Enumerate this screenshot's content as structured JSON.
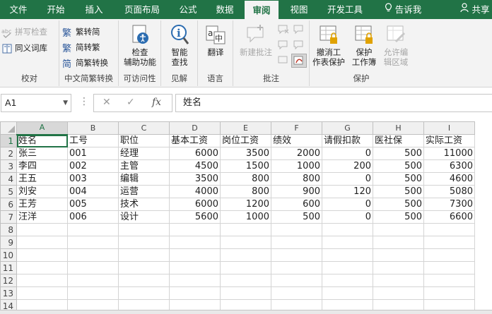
{
  "tabs": [
    {
      "label": "文件",
      "active": false
    },
    {
      "label": "开始",
      "active": false
    },
    {
      "label": "插入",
      "active": false
    },
    {
      "label": "页面布局",
      "active": false
    },
    {
      "label": "公式",
      "active": false
    },
    {
      "label": "数据",
      "active": false
    },
    {
      "label": "审阅",
      "active": true
    },
    {
      "label": "视图",
      "active": false
    },
    {
      "label": "开发工具",
      "active": false
    },
    {
      "label": "告诉我",
      "active": false,
      "icon": "lightbulb-icon"
    },
    {
      "label": "共享",
      "active": false,
      "icon": "person-icon"
    }
  ],
  "ribbon": {
    "proofing": {
      "label": "校对",
      "spell_check": "拼写检查",
      "thesaurus": "同义词库"
    },
    "chinese_conversion": {
      "label": "中文简繁转换",
      "to_simplified": "繁转简",
      "to_traditional": "简转繁",
      "convert": "简繁转换"
    },
    "accessibility": {
      "label": "可访问性",
      "check_l1": "检查",
      "check_l2": "辅助功能"
    },
    "insights": {
      "label": "见解",
      "smart_l1": "智能",
      "smart_l2": "查找"
    },
    "language": {
      "label": "语言",
      "translate": "翻译"
    },
    "comments": {
      "label": "批注",
      "new_comment": "新建批注"
    },
    "protect": {
      "label": "保护",
      "unprotect_l1": "撤消工",
      "unprotect_l2": "作表保护",
      "protect_wb_l1": "保护",
      "protect_wb_l2": "工作簿",
      "allow_edit_l1": "允许编",
      "allow_edit_l2": "辑区域"
    }
  },
  "formula_bar": {
    "name_box": "A1",
    "cancel": "✕",
    "enter": "✓",
    "fx": "fx",
    "content": "姓名"
  },
  "colors": {
    "accent": "#217346",
    "ribbon_bg": "#f3f3f3",
    "grid_line": "#d4d4d4"
  },
  "sheet": {
    "columns": [
      "A",
      "B",
      "C",
      "D",
      "E",
      "F",
      "G",
      "H",
      "I"
    ],
    "rows": [
      [
        "姓名",
        "工号",
        "职位",
        "基本工资",
        "岗位工资",
        "绩效",
        "请假扣款",
        "医社保",
        "实际工资"
      ],
      [
        "张三",
        "001",
        "经理",
        "6000",
        "3500",
        "2000",
        "0",
        "500",
        "11000"
      ],
      [
        "李四",
        "002",
        "主管",
        "4500",
        "1500",
        "1000",
        "200",
        "500",
        "6300"
      ],
      [
        "王五",
        "003",
        "编辑",
        "3500",
        "800",
        "800",
        "0",
        "500",
        "4600"
      ],
      [
        "刘安",
        "004",
        "运营",
        "4000",
        "800",
        "900",
        "120",
        "500",
        "5080"
      ],
      [
        "王芳",
        "005",
        "技术",
        "6000",
        "1200",
        "600",
        "0",
        "500",
        "7300"
      ],
      [
        "汪洋",
        "006",
        "设计",
        "5600",
        "1000",
        "500",
        "0",
        "500",
        "6600"
      ],
      [
        "",
        "",
        "",
        "",
        "",
        "",
        "",
        "",
        ""
      ],
      [
        "",
        "",
        "",
        "",
        "",
        "",
        "",
        "",
        ""
      ],
      [
        "",
        "",
        "",
        "",
        "",
        "",
        "",
        "",
        ""
      ],
      [
        "",
        "",
        "",
        "",
        "",
        "",
        "",
        "",
        ""
      ],
      [
        "",
        "",
        "",
        "",
        "",
        "",
        "",
        "",
        ""
      ],
      [
        "",
        "",
        "",
        "",
        "",
        "",
        "",
        "",
        ""
      ],
      [
        "",
        "",
        "",
        "",
        "",
        "",
        "",
        "",
        ""
      ]
    ],
    "row_numbers": [
      "1",
      "2",
      "3",
      "4",
      "5",
      "6",
      "7",
      "8",
      "9",
      "10",
      "11",
      "12",
      "13",
      "14"
    ],
    "selected_cell": "A1"
  }
}
